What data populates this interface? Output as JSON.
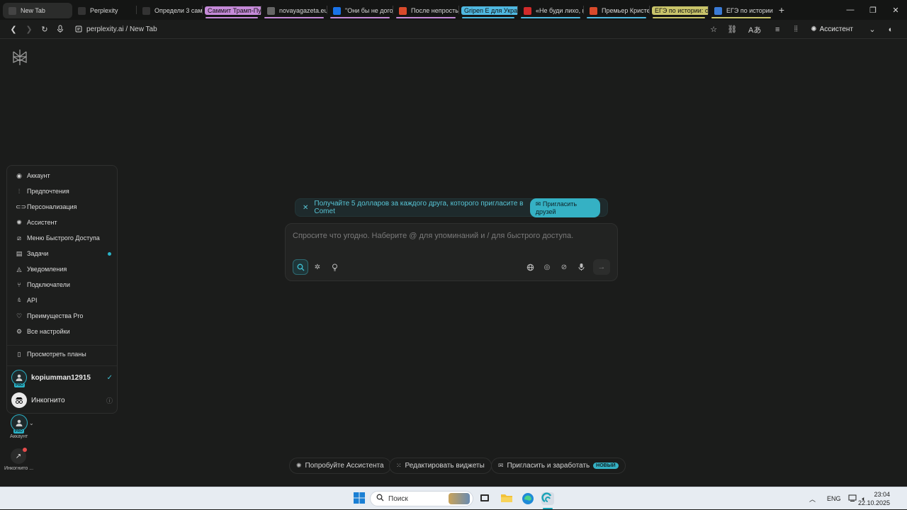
{
  "tabs": [
    {
      "title": "New Tab",
      "active": true,
      "favicon": "perplexity-icon",
      "fav_color": "#444"
    },
    {
      "title": "Perplexity",
      "active": false,
      "favicon": "perplexity-icon",
      "fav_color": "#333"
    },
    {
      "title": "Определи 3 сами",
      "active": false,
      "favicon": "perplexity-icon",
      "fav_color": "#333"
    },
    {
      "title": "Саммит Трамп-Пу",
      "active": false,
      "group": true,
      "group_color": "#c58ad8",
      "underline": "#c58ad8"
    },
    {
      "title": "novayagazeta.eu",
      "active": false,
      "favicon": "globe-icon",
      "fav_color": "#666",
      "underline": "#c58ad8"
    },
    {
      "title": "\"Они бы не догов",
      "active": false,
      "favicon": "news-icon",
      "fav_color": "#1a73e8",
      "underline": "#c58ad8"
    },
    {
      "title": "После непросты",
      "active": false,
      "favicon": "news-icon",
      "fav_color": "#d94a2b",
      "underline": "#c58ad8"
    },
    {
      "title": "Gripen E для Укра",
      "active": false,
      "group": true,
      "group_color": "#4fb8e0",
      "underline": "#4fb8e0"
    },
    {
      "title": "«Не буди лихо, по",
      "active": false,
      "favicon": "news-icon",
      "fav_color": "#d12b2b",
      "underline": "#4fb8e0"
    },
    {
      "title": "Премьер Кристер",
      "active": false,
      "favicon": "news-icon",
      "fav_color": "#d94a2b",
      "underline": "#4fb8e0"
    },
    {
      "title": "ЕГЭ по истории: с",
      "active": false,
      "group": true,
      "group_color": "#c9c46a",
      "underline": "#c9c46a"
    },
    {
      "title": "ЕГЭ по истории д",
      "active": false,
      "favicon": "news-icon",
      "fav_color": "#3a7bd5",
      "underline": "#c9c46a"
    }
  ],
  "toolbar": {
    "url": "perplexity.ai / New Tab",
    "assistant_label": "Ассистент"
  },
  "menu": {
    "items": [
      {
        "label": "Аккаунт",
        "icon": "user-circle-icon"
      },
      {
        "label": "Предпочтения",
        "icon": "sliders-icon"
      },
      {
        "label": "Персонализация",
        "icon": "toggle-icon"
      },
      {
        "label": "Ассистент",
        "icon": "assistant-icon"
      },
      {
        "label": "Меню Быстрого Доступа",
        "icon": "shortcut-icon"
      },
      {
        "label": "Задачи",
        "icon": "tasks-icon",
        "dot": true
      },
      {
        "label": "Уведомления",
        "icon": "bell-icon"
      },
      {
        "label": "Подключатели",
        "icon": "connector-icon"
      },
      {
        "label": "API",
        "icon": "api-icon"
      },
      {
        "label": "Преимущества Pro",
        "icon": "heart-icon"
      },
      {
        "label": "Все настройки",
        "icon": "gear-icon"
      }
    ],
    "plans_label": "Просмотреть планы",
    "user": {
      "name": "kopiumman12915",
      "badge": "PRO"
    },
    "incognito_label": "Инкогнито"
  },
  "sidebar": {
    "account_label": "Аккаунт",
    "incognito_label": "Инкогнито ..."
  },
  "promo": {
    "text": "Получайте 5 долларов за каждого друга, которого пригласите в Comet",
    "button": "Пригласить друзей"
  },
  "composer": {
    "placeholder": "Спросите что угодно. Наберите @ для упоминаний и / для быстрого доступа."
  },
  "bottom": {
    "try_assistant": "Попробуйте Ассистента",
    "edit_widgets": "Редактировать виджеты",
    "invite_earn": "Пригласить и заработать",
    "new_badge": "НОВЫЙ"
  },
  "taskbar": {
    "search_placeholder": "Поиск",
    "lang": "ENG",
    "time": "23:04",
    "date": "22.10.2025"
  },
  "colors": {
    "accent": "#35b1c4",
    "background": "#1b1c1b"
  }
}
